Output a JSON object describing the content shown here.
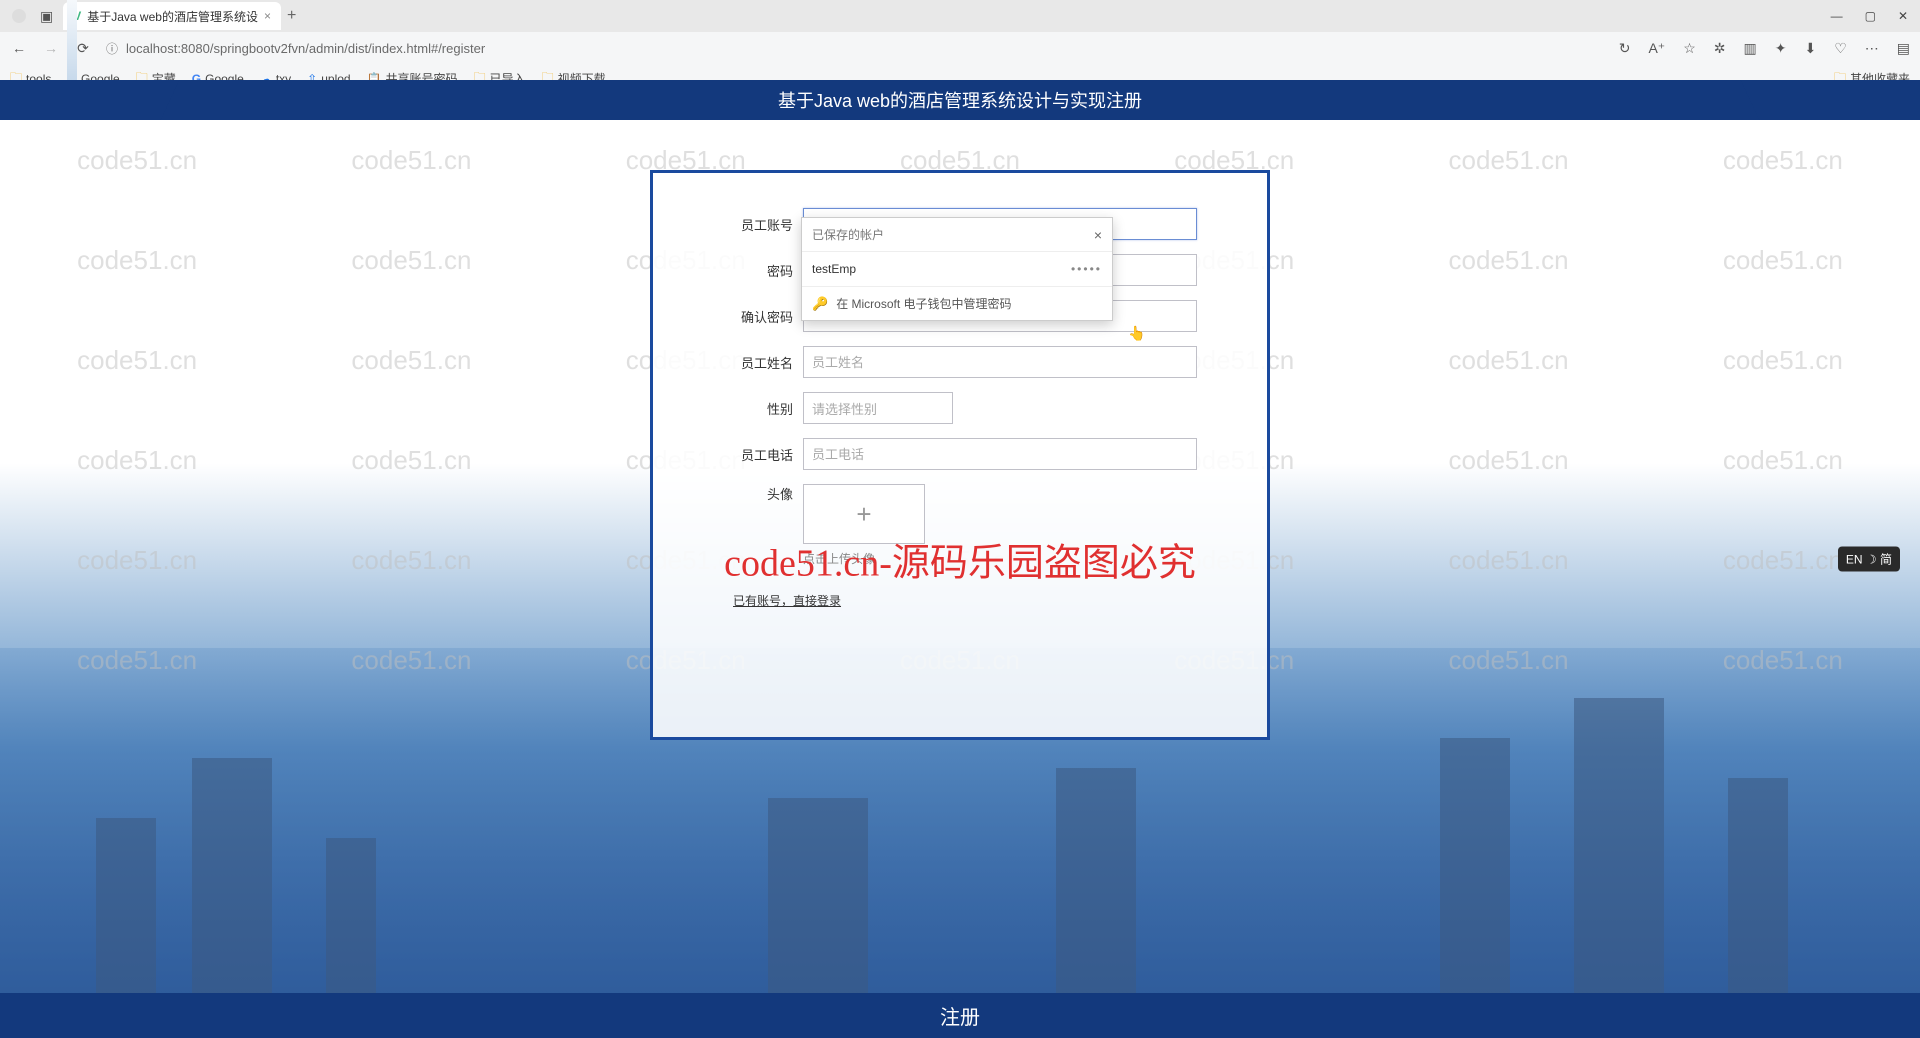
{
  "browser": {
    "tab_title": "基于Java web的酒店管理系统设",
    "url": "localhost:8080/springbootv2fvn/admin/dist/index.html#/register",
    "bookmarks": [
      "tools",
      "Google",
      "宝藏",
      "Google",
      "txy",
      "uplod",
      "共享账号密码",
      "已导入",
      "视频下载"
    ],
    "other_bookmarks": "其他收藏夹"
  },
  "page": {
    "header_title": "基于Java web的酒店管理系统设计与实现注册",
    "watermark_text": "code51.cn",
    "watermark_center": "code51.cn-源码乐园盗图必究",
    "form": {
      "labels": {
        "account": "员工账号",
        "password": "密码",
        "confirm": "确认密码",
        "name": "员工姓名",
        "gender": "性别",
        "phone": "员工电话",
        "avatar": "头像"
      },
      "account_value": "testEmp",
      "name_placeholder": "员工姓名",
      "gender_placeholder": "请选择性别",
      "phone_placeholder": "员工电话",
      "avatar_hint": "点击上传头像",
      "login_link": "已有账号，直接登录",
      "register_btn": "注册"
    },
    "autocomplete": {
      "header": "已保存的帐户",
      "item_user": "testEmp",
      "item_pass": "•••••",
      "footer": "在 Microsoft 电子钱包中管理密码"
    },
    "lang_badge": "EN ☽ 简"
  }
}
